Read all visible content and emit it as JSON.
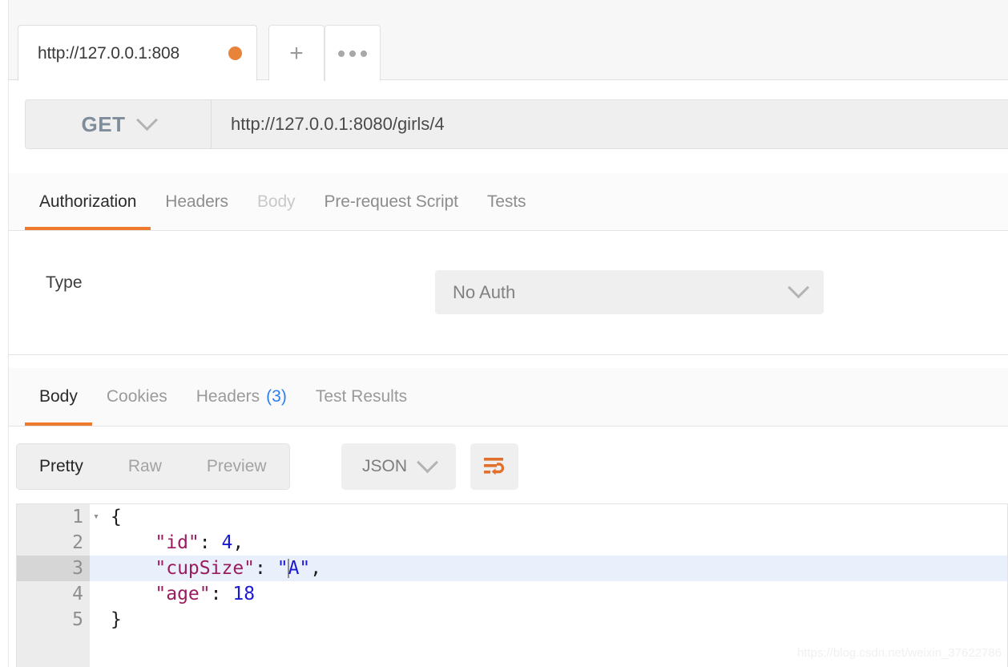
{
  "tabbar": {
    "tabs": [
      {
        "label": "http://127.0.0.1:808",
        "unsaved": true
      }
    ],
    "new_tab_icon": "plus-icon",
    "more_icon": "ellipsis-icon",
    "unsaved_dot_color": "#e8833a"
  },
  "request": {
    "method": "GET",
    "url": "http://127.0.0.1:8080/girls/4",
    "tabs": [
      {
        "label": "Authorization",
        "state": "active"
      },
      {
        "label": "Headers",
        "state": "normal"
      },
      {
        "label": "Body",
        "state": "disabled"
      },
      {
        "label": "Pre-request Script",
        "state": "normal"
      },
      {
        "label": "Tests",
        "state": "normal"
      }
    ],
    "auth": {
      "type_label": "Type",
      "type_value": "No Auth"
    }
  },
  "response": {
    "tabs": [
      {
        "label": "Body",
        "count": "",
        "state": "active"
      },
      {
        "label": "Cookies",
        "count": "",
        "state": "normal"
      },
      {
        "label": "Headers",
        "count": "(3)",
        "state": "normal"
      },
      {
        "label": "Test Results",
        "count": "",
        "state": "normal"
      }
    ],
    "toolbar": {
      "views": [
        {
          "label": "Pretty",
          "state": "active"
        },
        {
          "label": "Raw",
          "state": "normal"
        },
        {
          "label": "Preview",
          "state": "normal"
        }
      ],
      "format": "JSON",
      "wrap_icon": "word-wrap-icon"
    },
    "body": {
      "lines": [
        {
          "num": "1",
          "fold": "▾",
          "highlight": false,
          "segments": [
            {
              "t": "{",
              "c": "plain"
            }
          ]
        },
        {
          "num": "2",
          "fold": "",
          "highlight": false,
          "segments": [
            {
              "t": "    ",
              "c": "plain"
            },
            {
              "t": "\"id\"",
              "c": "key"
            },
            {
              "t": ": ",
              "c": "plain"
            },
            {
              "t": "4",
              "c": "num"
            },
            {
              "t": ",",
              "c": "plain"
            }
          ]
        },
        {
          "num": "3",
          "fold": "",
          "highlight": true,
          "caret_after": 3,
          "segments": [
            {
              "t": "    ",
              "c": "plain"
            },
            {
              "t": "\"cupSize\"",
              "c": "key"
            },
            {
              "t": ": ",
              "c": "plain"
            },
            {
              "t": "\"",
              "c": "str"
            },
            {
              "t": "A\"",
              "c": "str"
            },
            {
              "t": ",",
              "c": "plain"
            }
          ]
        },
        {
          "num": "4",
          "fold": "",
          "highlight": false,
          "segments": [
            {
              "t": "    ",
              "c": "plain"
            },
            {
              "t": "\"age\"",
              "c": "key"
            },
            {
              "t": ": ",
              "c": "plain"
            },
            {
              "t": "18",
              "c": "num"
            }
          ]
        },
        {
          "num": "5",
          "fold": "",
          "highlight": false,
          "segments": [
            {
              "t": "}",
              "c": "plain"
            }
          ]
        }
      ]
    }
  },
  "watermark": "https://blog.csdn.net/weixin_37622786",
  "colors": {
    "accent": "#ef7a2e",
    "link": "#2d7ff0",
    "json_key": "#9b1b5e",
    "json_value": "#1a1ad0",
    "highlight_row": "#e9f0fb"
  }
}
